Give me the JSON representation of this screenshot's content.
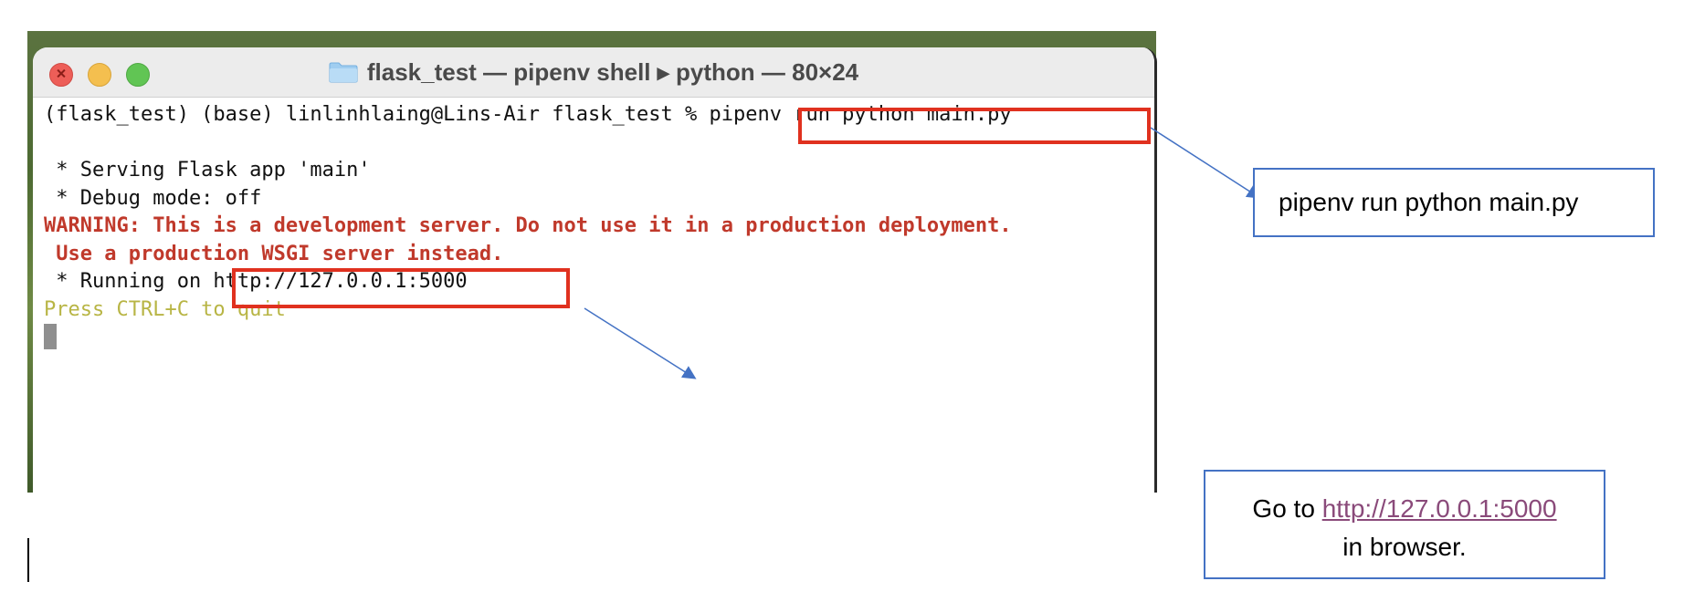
{
  "window": {
    "title": "flask_test — pipenv shell ▸ python — 80×24"
  },
  "terminal": {
    "lines": [
      "(flask_test) (base) linlinhlaing@Lins-Air flask_test % pipenv run python main.py",
      "",
      " * Serving Flask app 'main'",
      " * Debug mode: off",
      "WARNING: This is a development server. Do not use it in a production deployment.",
      " Use a production WSGI server instead.",
      " * Running on http://127.0.0.1:5000",
      "Press CTRL+C to quit"
    ]
  },
  "annotations": {
    "command_callout": "pipenv run python main.py",
    "browser_callout": {
      "prefix": "Go to ",
      "url": "http://127.0.0.1:5000",
      "suffix": "in browser."
    }
  },
  "colors": {
    "highlight": "#e0311f",
    "callout_border": "#4472c4",
    "warning_text": "#c0392b",
    "quit_text": "#b8b545",
    "link": "#8a4a7a"
  }
}
